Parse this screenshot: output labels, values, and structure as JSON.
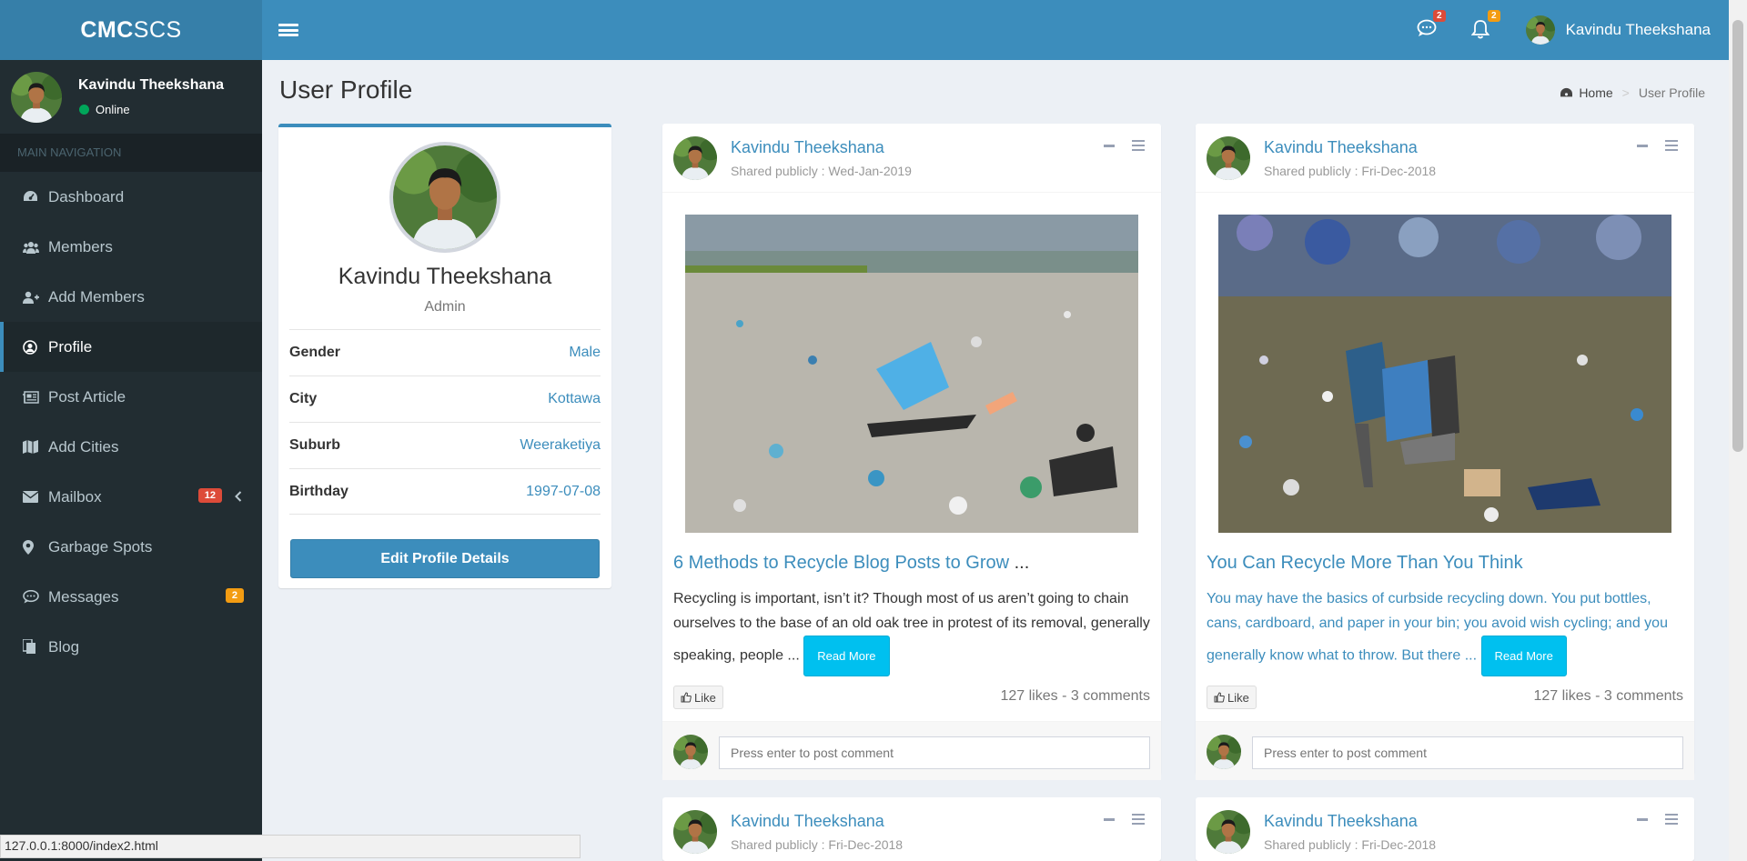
{
  "brand": {
    "bold": "CMC",
    "light": "SCS"
  },
  "sidebar": {
    "user": {
      "name": "Kavindu Theekshana",
      "status": "Online"
    },
    "nav_header": "MAIN NAVIGATION",
    "items": [
      {
        "label": "Dashboard",
        "icon": "dashboard-icon"
      },
      {
        "label": "Members",
        "icon": "users-icon"
      },
      {
        "label": "Add Members",
        "icon": "user-plus-icon"
      },
      {
        "label": "Profile",
        "icon": "user-circle-icon",
        "active": true
      },
      {
        "label": "Post Article",
        "icon": "newspaper-icon"
      },
      {
        "label": "Add Cities",
        "icon": "map-icon"
      },
      {
        "label": "Mailbox",
        "icon": "envelope-icon",
        "badge": "12"
      },
      {
        "label": "Garbage Spots",
        "icon": "map-marker-icon"
      },
      {
        "label": "Messages",
        "icon": "comments-icon",
        "badge": "2"
      },
      {
        "label": "Blog",
        "icon": "files-icon"
      }
    ]
  },
  "topbar": {
    "messages_count": "2",
    "notifications_count": "2",
    "user_name": "Kavindu Theekshana"
  },
  "page": {
    "title": "User Profile",
    "breadcrumb": {
      "home": "Home",
      "current": "User Profile"
    }
  },
  "profile": {
    "name": "Kavindu Theekshana",
    "role": "Admin",
    "fields": [
      {
        "label": "Gender",
        "value": "Male"
      },
      {
        "label": "City",
        "value": "Kottawa"
      },
      {
        "label": "Suburb",
        "value": "Weeraketiya"
      },
      {
        "label": "Birthday",
        "value": "1997-07-08"
      }
    ],
    "edit_button": "Edit Profile Details"
  },
  "posts": [
    {
      "author": "Kavindu Theekshana",
      "shared": "Shared publicly : Wed-Jan-2019",
      "title": "6 Methods to Recycle Blog Posts to Grow",
      "title_suffix": " ...",
      "text": "Recycling is important, isn’t it? Though most of us aren’t going to chain ourselves to the base of an old oak tree in protest of its removal, generally speaking, people ... ",
      "read_more": "Read More",
      "like": "Like",
      "stats": "127 likes - 3 comments",
      "comment_placeholder": "Press enter to post comment"
    },
    {
      "author": "Kavindu Theekshana",
      "shared": "Shared publicly : Fri-Dec-2018",
      "title": "You Can Recycle More Than You Think",
      "text": "You may have the basics of curbside recycling down. You put bottles, cans, cardboard, and paper in your bin; you avoid wish cycling; and you generally know what to throw. But there ... ",
      "read_more": "Read More",
      "like": "Like",
      "stats": "127 likes - 3 comments",
      "comment_placeholder": "Press enter to post comment"
    },
    {
      "author": "Kavindu Theekshana",
      "shared": "Shared publicly : Fri-Dec-2018"
    },
    {
      "author": "Kavindu Theekshana",
      "shared": "Shared publicly : Fri-Dec-2018"
    }
  ],
  "status_url": "127.0.0.1:8000/index2.html",
  "colors": {
    "primary": "#3c8dbc",
    "sidebar": "#222d32",
    "info": "#00c0ef",
    "warning": "#f39c12",
    "danger": "#dd4b39",
    "success": "#00a65a"
  }
}
